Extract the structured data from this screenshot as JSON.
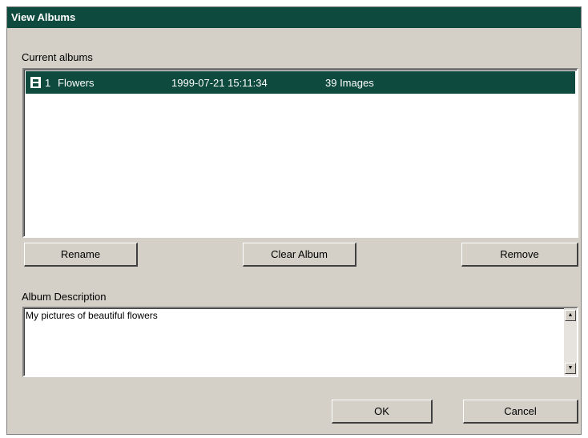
{
  "dialog": {
    "title": "View Albums",
    "current_albums_label": "Current albums",
    "albums": [
      {
        "number": "1",
        "name": "Flowers",
        "date": "1999-07-21 15:11:34",
        "images": "39 Images"
      }
    ],
    "buttons": {
      "rename": "Rename",
      "clear_album": "Clear Album",
      "remove": "Remove",
      "ok": "OK",
      "cancel": "Cancel"
    },
    "description_label": "Album Description",
    "description_value": "My pictures of beautiful flowers",
    "scroll_up_icon": "▲",
    "scroll_down_icon": "▼"
  }
}
